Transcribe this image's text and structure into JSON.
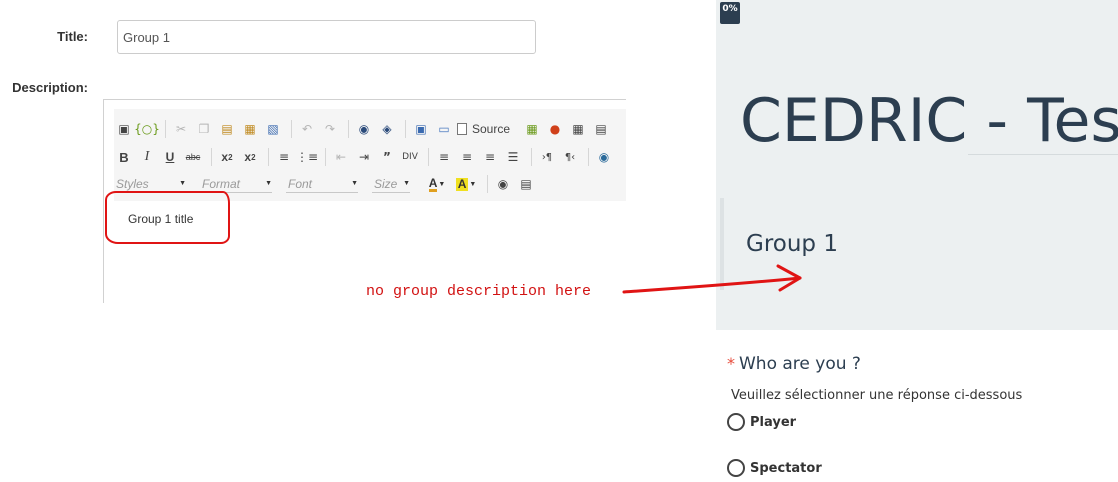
{
  "form": {
    "title_label": "Title:",
    "title_value": "Group 1",
    "description_label": "Description:"
  },
  "editor": {
    "source_label": "Source",
    "combos": {
      "styles": "Styles",
      "format": "Format",
      "font": "Font",
      "size": "Size"
    },
    "content": "Group 1 title",
    "icons_row1": [
      "maximize-icon",
      "show-blocks-icon",
      "cut-icon",
      "copy-icon",
      "paste-icon",
      "paste-text-icon",
      "paste-word-icon",
      "undo-icon",
      "redo-icon",
      "find-icon",
      "replace-icon",
      "select-all-icon",
      "remove-format-icon",
      "source-icon",
      "image-icon",
      "flash-icon",
      "table-icon",
      "horizontal-rule-icon"
    ],
    "icons_row2": [
      "bold-icon",
      "italic-icon",
      "underline-icon",
      "strike-icon",
      "subscript-icon",
      "superscript-icon",
      "numbered-list-icon",
      "bulleted-list-icon",
      "outdent-icon",
      "indent-icon",
      "blockquote-icon",
      "creatediv-icon",
      "align-left-icon",
      "align-center-icon",
      "align-right-icon",
      "justify-icon",
      "ltr-icon",
      "rtl-icon",
      "link-icon"
    ],
    "icons_row3": [
      "text-color-icon",
      "bg-color-icon",
      "preview-icon",
      "templates-icon"
    ]
  },
  "annotation": {
    "text": "no group description here",
    "color": "#d21212"
  },
  "survey": {
    "progress": "0%",
    "progress_value": 0,
    "title": "CEDRIC - Test",
    "group_title": "Group 1",
    "question_required_mark": "*",
    "question": "Who are you ?",
    "help": "Veuillez sélectionner une réponse ci-dessous",
    "options": [
      "Player",
      "Spectator"
    ],
    "colors": {
      "heading": "#2c3e50",
      "band": "#ecf0f1",
      "required": "#e74c3c"
    }
  }
}
